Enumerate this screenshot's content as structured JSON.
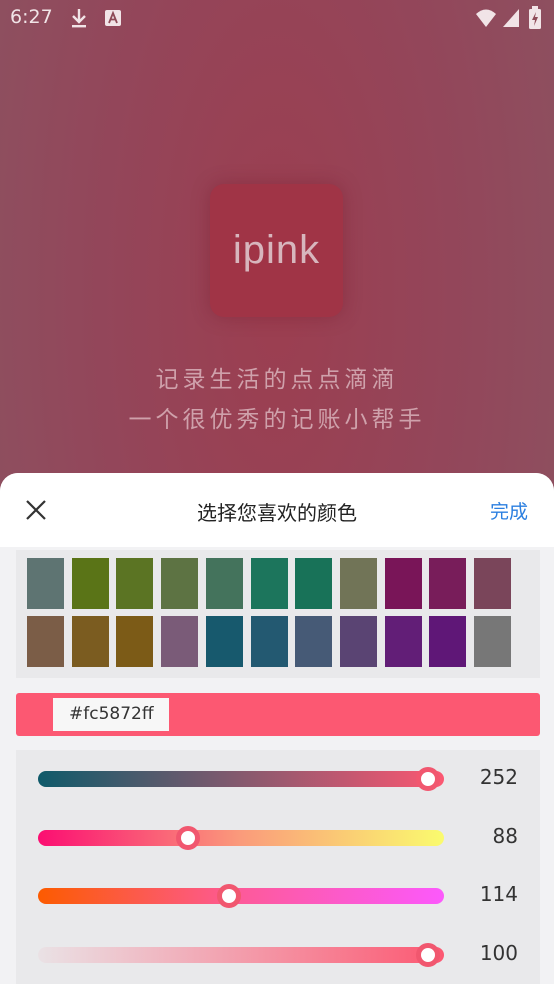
{
  "status_bar": {
    "time": "6:27",
    "icons": [
      "download-icon",
      "a-badge-icon",
      "wifi-icon",
      "signal-icon",
      "battery-icon"
    ]
  },
  "splash": {
    "logo_text": "ipink",
    "slogan_line1": "记录生活的点点滴滴",
    "slogan_line2": "一个很优秀的记账小帮手"
  },
  "picker": {
    "title": "选择您喜欢的颜色",
    "done_label": "完成",
    "close_icon": "close-icon",
    "palette": [
      [
        "#5e7472",
        "#5a7417",
        "#5b7423",
        "#5d7343",
        "#44735c",
        "#1c755c",
        "#187258",
        "#717457",
        "#791558",
        "#781d5a",
        "#7a455a"
      ],
      [
        "#7b5d47",
        "#7b5c20",
        "#7c5b17",
        "#7a5b78",
        "#17596d",
        "#235971",
        "#465a76",
        "#5a4473",
        "#621e77",
        "#5f1777",
        "#777777"
      ]
    ],
    "current_hex": "#fc5872ff",
    "current_color": "#fc5872",
    "sliders": [
      {
        "name": "red",
        "value": 252,
        "fraction": 0.96,
        "gradient": [
          "#0f5a6a",
          "#fc5872"
        ]
      },
      {
        "name": "green",
        "value": 88,
        "fraction": 0.37,
        "gradient": [
          "#fb0e72",
          "#fa9b7b",
          "#fafb6e"
        ]
      },
      {
        "name": "blue",
        "value": 114,
        "fraction": 0.47,
        "gradient": [
          "#fc5b00",
          "#fd5a9a",
          "#fc59fc"
        ]
      },
      {
        "name": "alpha",
        "value": 100,
        "fraction": 0.96,
        "gradient": [
          "rgba(252,88,114,0.05)",
          "#fc5872"
        ]
      }
    ]
  }
}
